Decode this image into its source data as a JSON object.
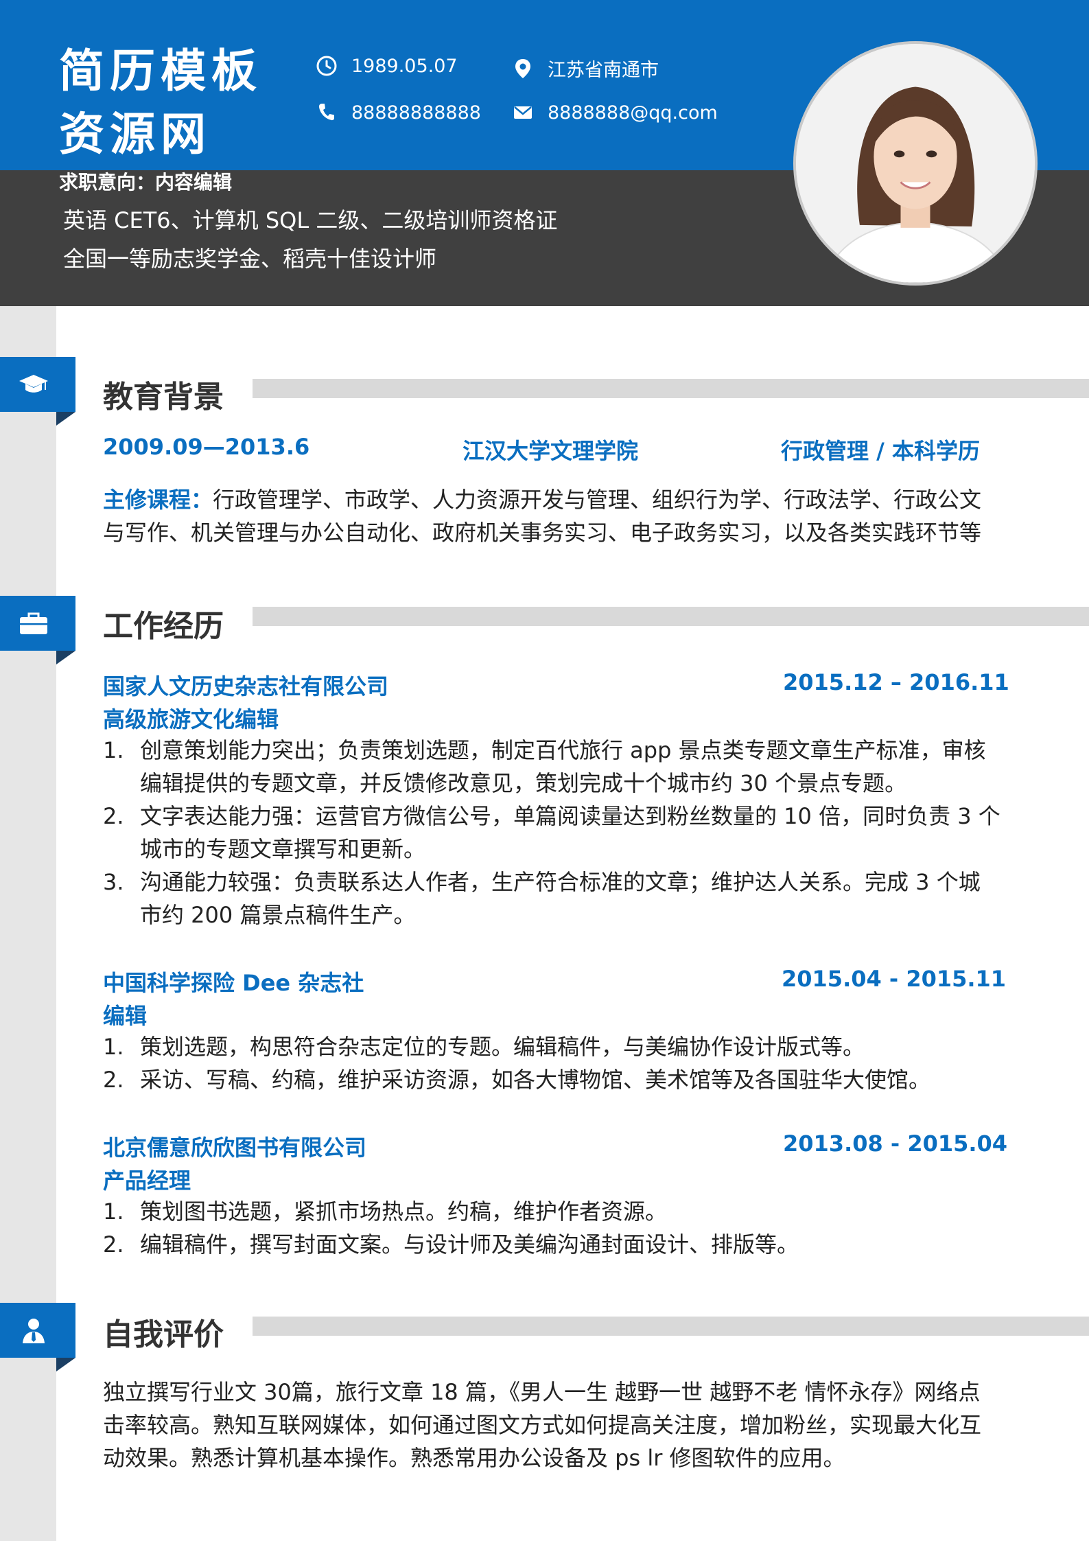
{
  "header": {
    "name_line1": "简历模板",
    "name_line2": "资源网",
    "birth": "1989.05.07",
    "location": "江苏省南通市",
    "phone": "88888888888",
    "email": "8888888@qq.com",
    "intent": "求职意向：内容编辑",
    "cert_line1": "英语 CET6、计算机 SQL 二级、二级培训师资格证",
    "cert_line2": "全国一等励志奖学金、稻壳十佳设计师"
  },
  "education": {
    "title": "教育背景",
    "period": "2009.09—2013.6",
    "school": "江汉大学文理学院",
    "major": "行政管理  /  本科学历",
    "courses_label": "主修课程：",
    "courses_text": "行政管理学、市政学、人力资源开发与管理、组织行为学、行政法学、行政公文与写作、机关管理与办公自动化、政府机关事务实习、电子政务实习，以及各类实践环节等"
  },
  "work": {
    "title": "工作经历",
    "jobs": [
      {
        "company": "国家人文历史杂志社有限公司",
        "period": "2015.12 – 2016.11",
        "role": "高级旅游文化编辑",
        "items": [
          {
            "num": "1.",
            "text": "创意策划能力突出；负责策划选题，制定百代旅行 app 景点类专题文章生产标准，审核编辑提供的专题文章，并反馈修改意见，策划完成十个城市约 30 个景点专题。"
          },
          {
            "num": "2.",
            "text": "文字表达能力强：运营官方微信公号，单篇阅读量达到粉丝数量的 10 倍，同时负责 3 个城市的专题文章撰写和更新。"
          },
          {
            "num": "3.",
            "text": "沟通能力较强：负责联系达人作者，生产符合标准的文章；维护达人关系。完成 3 个城市约 200 篇景点稿件生产。"
          }
        ]
      },
      {
        "company": "中国科学探险 Dee 杂志社",
        "period": "2015.04 - 2015.11",
        "role": "编辑",
        "items": [
          {
            "num": "1.",
            "text": "策划选题，构思符合杂志定位的专题。编辑稿件，与美编协作设计版式等。"
          },
          {
            "num": "2.",
            "text": "采访、写稿、约稿，维护采访资源，如各大博物馆、美术馆等及各国驻华大使馆。"
          }
        ]
      },
      {
        "company": "北京儒意欣欣图书有限公司",
        "period": "2013.08 - 2015.04",
        "role": "产品经理",
        "items": [
          {
            "num": "1.",
            "text": "策划图书选题，紧抓市场热点。约稿，维护作者资源。"
          },
          {
            "num": "2.",
            "text": "编辑稿件，撰写封面文案。与设计师及美编沟通封面设计、排版等。"
          }
        ]
      }
    ]
  },
  "self": {
    "title": "自我评价",
    "text": "独立撰写行业文 30篇，旅行文章  18  篇，《男人一生  越野一世  越野不老  情怀永存》网络点击率较高。熟知互联网媒体，如何通过图文方式如何提高关注度，增加粉丝，实现最大化互动效果。熟悉计算机基本操作。熟悉常用办公设备及 ps lr 修图软件的应用。"
  },
  "icons": {
    "birth": "clock-icon",
    "location": "map-pin-icon",
    "phone": "phone-icon",
    "email": "envelope-icon",
    "education": "graduation-cap-icon",
    "work": "briefcase-icon",
    "self": "person-icon"
  },
  "colors": {
    "accent": "#0a6ec0",
    "dark": "#404040",
    "strip": "#e6e6e6",
    "bar": "#d9d9d9"
  }
}
